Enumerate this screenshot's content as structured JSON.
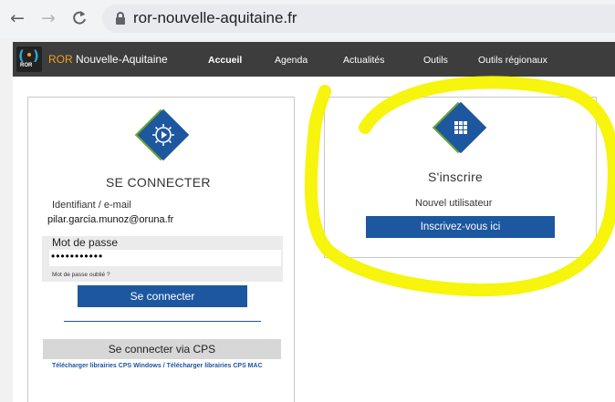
{
  "browser": {
    "url": "ror-nouvelle-aquitaine.fr",
    "back_glyph": "←",
    "forward_glyph": "→",
    "reload_glyph": "C"
  },
  "header": {
    "logo_text": "ROR",
    "brand_prefix": "ROR",
    "brand_rest": " Nouvelle-Aquitaine",
    "menu": [
      {
        "label": "Accueil"
      },
      {
        "label": "Agenda"
      },
      {
        "label": "Actualités"
      },
      {
        "label": "Outils"
      },
      {
        "label": "Outils régionaux"
      }
    ]
  },
  "login": {
    "title": "SE CONNECTER",
    "identifier_label": "Identifiant / e-mail",
    "identifier_value": "pilar.garcia.munoz@oruna.fr",
    "password_label": "Mot de passe",
    "password_value": "•••••••••••",
    "forgot_label": "Mot de passe oublié ?",
    "submit_label": "Se connecter",
    "cps_label": "Se connecter via CPS",
    "cps_links": "Télécharger librairies CPS Windows / Télécharger librairies CPS MAC"
  },
  "signup": {
    "title": "S'inscrire",
    "subtitle": "Nouvel utilisateur",
    "button_label": "Inscrivez-vous ici"
  },
  "colors": {
    "brand_blue": "#1c57a0",
    "brand_green": "#6ba534",
    "brand_orange": "#f0a020",
    "header_bg": "#3d3d3d",
    "highlight": "#f7f300"
  },
  "icons": [
    "back-arrow-icon",
    "forward-arrow-icon",
    "reload-icon",
    "lock-icon",
    "gear-play-icon",
    "grid-icon"
  ]
}
